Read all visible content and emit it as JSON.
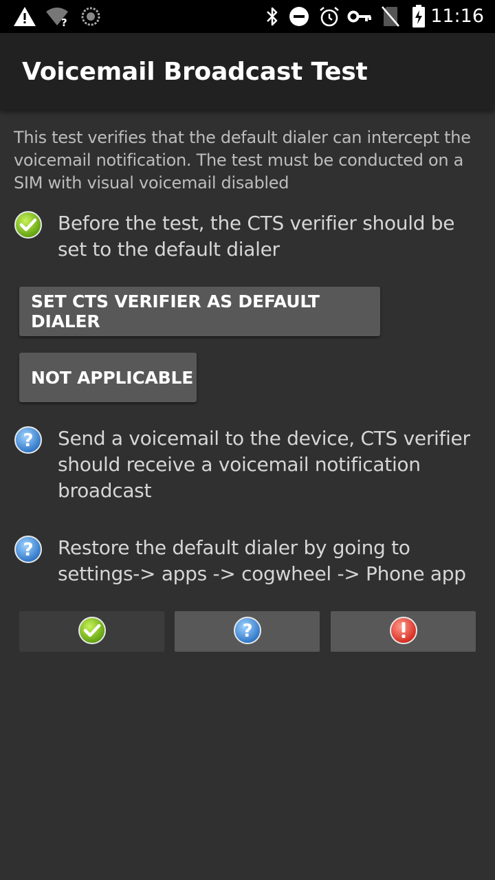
{
  "status_bar": {
    "time": "11:16",
    "icons": [
      "warning-icon",
      "wifi-unknown-icon",
      "sync-icon",
      "bluetooth-icon",
      "do-not-disturb-icon",
      "alarm-icon",
      "vpn-key-icon",
      "no-sim-icon",
      "battery-charging-icon"
    ]
  },
  "app_bar": {
    "title": "Voicemail Broadcast Test"
  },
  "intro": "This test verifies that the default dialer can intercept the voicemail notification. The test must be conducted on a SIM with visual voicemail disabled",
  "steps": [
    {
      "status": "passed",
      "icon": "check-circle-icon",
      "text": "Before the test, the CTS verifier should be set to the default dialer"
    },
    {
      "status": "pending",
      "icon": "question-circle-icon",
      "text": "Send a voicemail to the device, CTS verifier should receive a voicemail notification broadcast"
    },
    {
      "status": "pending",
      "icon": "question-circle-icon",
      "text": "Restore the default dialer by going to settings-> apps -> cogwheel -> Phone app"
    }
  ],
  "buttons": {
    "set_default_dialer": "SET CTS VERIFIER AS DEFAULT DIALER",
    "not_applicable": "NOT APPLICABLE"
  },
  "result_buttons": [
    "pass-icon",
    "info-icon",
    "fail-icon"
  ],
  "colors": {
    "background": "#303030",
    "app_bar": "#212121",
    "button": "#585858",
    "pass": "#7cc41f",
    "info": "#3d8fd8",
    "fail": "#e53a2e"
  }
}
